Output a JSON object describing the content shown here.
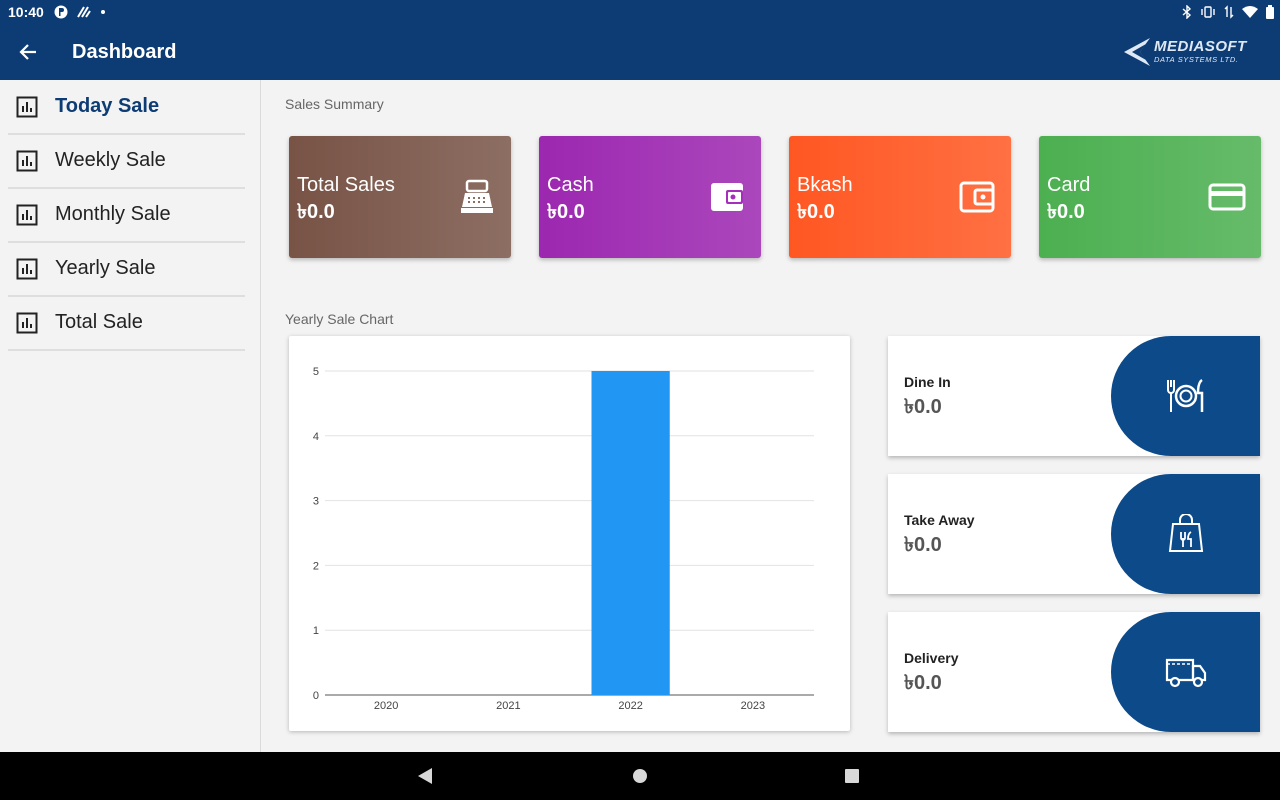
{
  "status_bar": {
    "time": "10:40"
  },
  "app_bar": {
    "title": "Dashboard",
    "logo_brand": "MEDIASOFT",
    "logo_subtitle": "DATA SYSTEMS LTD."
  },
  "sidebar": {
    "items": [
      {
        "label": "Today Sale",
        "active": true
      },
      {
        "label": "Weekly Sale"
      },
      {
        "label": "Monthly Sale"
      },
      {
        "label": "Yearly Sale"
      },
      {
        "label": "Total Sale"
      }
    ]
  },
  "sales_summary": {
    "title": "Sales Summary",
    "cards": [
      {
        "label": "Total Sales",
        "value": "৳0.0",
        "icon": "cash-register-icon",
        "color": "#795548"
      },
      {
        "label": "Cash",
        "value": "৳0.0",
        "icon": "wallet-icon",
        "color": "#9c27b0"
      },
      {
        "label": "Bkash",
        "value": "৳0.0",
        "icon": "wallet-icon",
        "color": "#ff5722"
      },
      {
        "label": "Card",
        "value": "৳0.0",
        "icon": "credit-card-icon",
        "color": "#4caf50"
      }
    ]
  },
  "yearly_chart": {
    "title": "Yearly Sale Chart"
  },
  "chart_data": {
    "type": "bar",
    "categories": [
      "2020",
      "2021",
      "2022",
      "2023"
    ],
    "values": [
      0,
      0,
      5,
      0
    ],
    "ylim": [
      0,
      5
    ],
    "yticks": [
      "0",
      "1",
      "2",
      "3",
      "4",
      "5"
    ],
    "grid": true,
    "bar_color": "#2196f3"
  },
  "order_types": [
    {
      "label": "Dine In",
      "value": "৳0.0",
      "icon": "plate-cutlery-icon"
    },
    {
      "label": "Take Away",
      "value": "৳0.0",
      "icon": "takeaway-bag-icon"
    },
    {
      "label": "Delivery",
      "value": "৳0.0",
      "icon": "delivery-truck-icon"
    }
  ],
  "colors": {
    "primary": "#0d3c74",
    "accent": "#0d4a8a"
  }
}
